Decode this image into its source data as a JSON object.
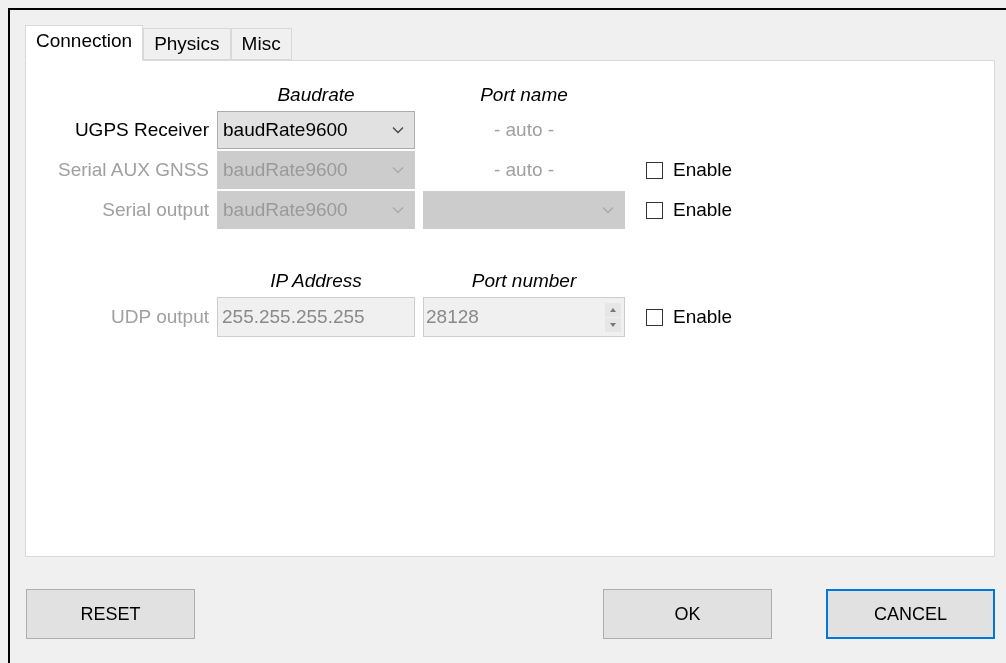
{
  "tabs": [
    {
      "label": "Connection",
      "selected": true
    },
    {
      "label": "Physics",
      "selected": false
    },
    {
      "label": "Misc",
      "selected": false
    }
  ],
  "serial": {
    "headers": [
      "Baudrate",
      "Port name"
    ],
    "rows": [
      {
        "label": "UGPS Receiver",
        "disabled": false,
        "baudrate": "baudRate9600",
        "port": {
          "kind": "text",
          "text": "- auto -"
        }
      },
      {
        "label": "Serial AUX GNSS",
        "disabled": true,
        "baudrate": "baudRate9600",
        "port": {
          "kind": "text",
          "text": "- auto -"
        },
        "enable": {
          "label": "Enable",
          "checked": false
        }
      },
      {
        "label": "Serial output",
        "disabled": true,
        "baudrate": "baudRate9600",
        "port": {
          "kind": "combo"
        },
        "enable": {
          "label": "Enable",
          "checked": false
        }
      }
    ]
  },
  "udp": {
    "headers": [
      "IP Address",
      "Port number"
    ],
    "label": "UDP output",
    "disabled": true,
    "ip": "255.255.255.255",
    "port": "28128",
    "enable": {
      "label": "Enable",
      "checked": false
    }
  },
  "buttons": [
    {
      "label": "RESET",
      "focused": false
    },
    {
      "label": "OK",
      "focused": false
    },
    {
      "label": "CANCEL",
      "focused": true
    }
  ]
}
